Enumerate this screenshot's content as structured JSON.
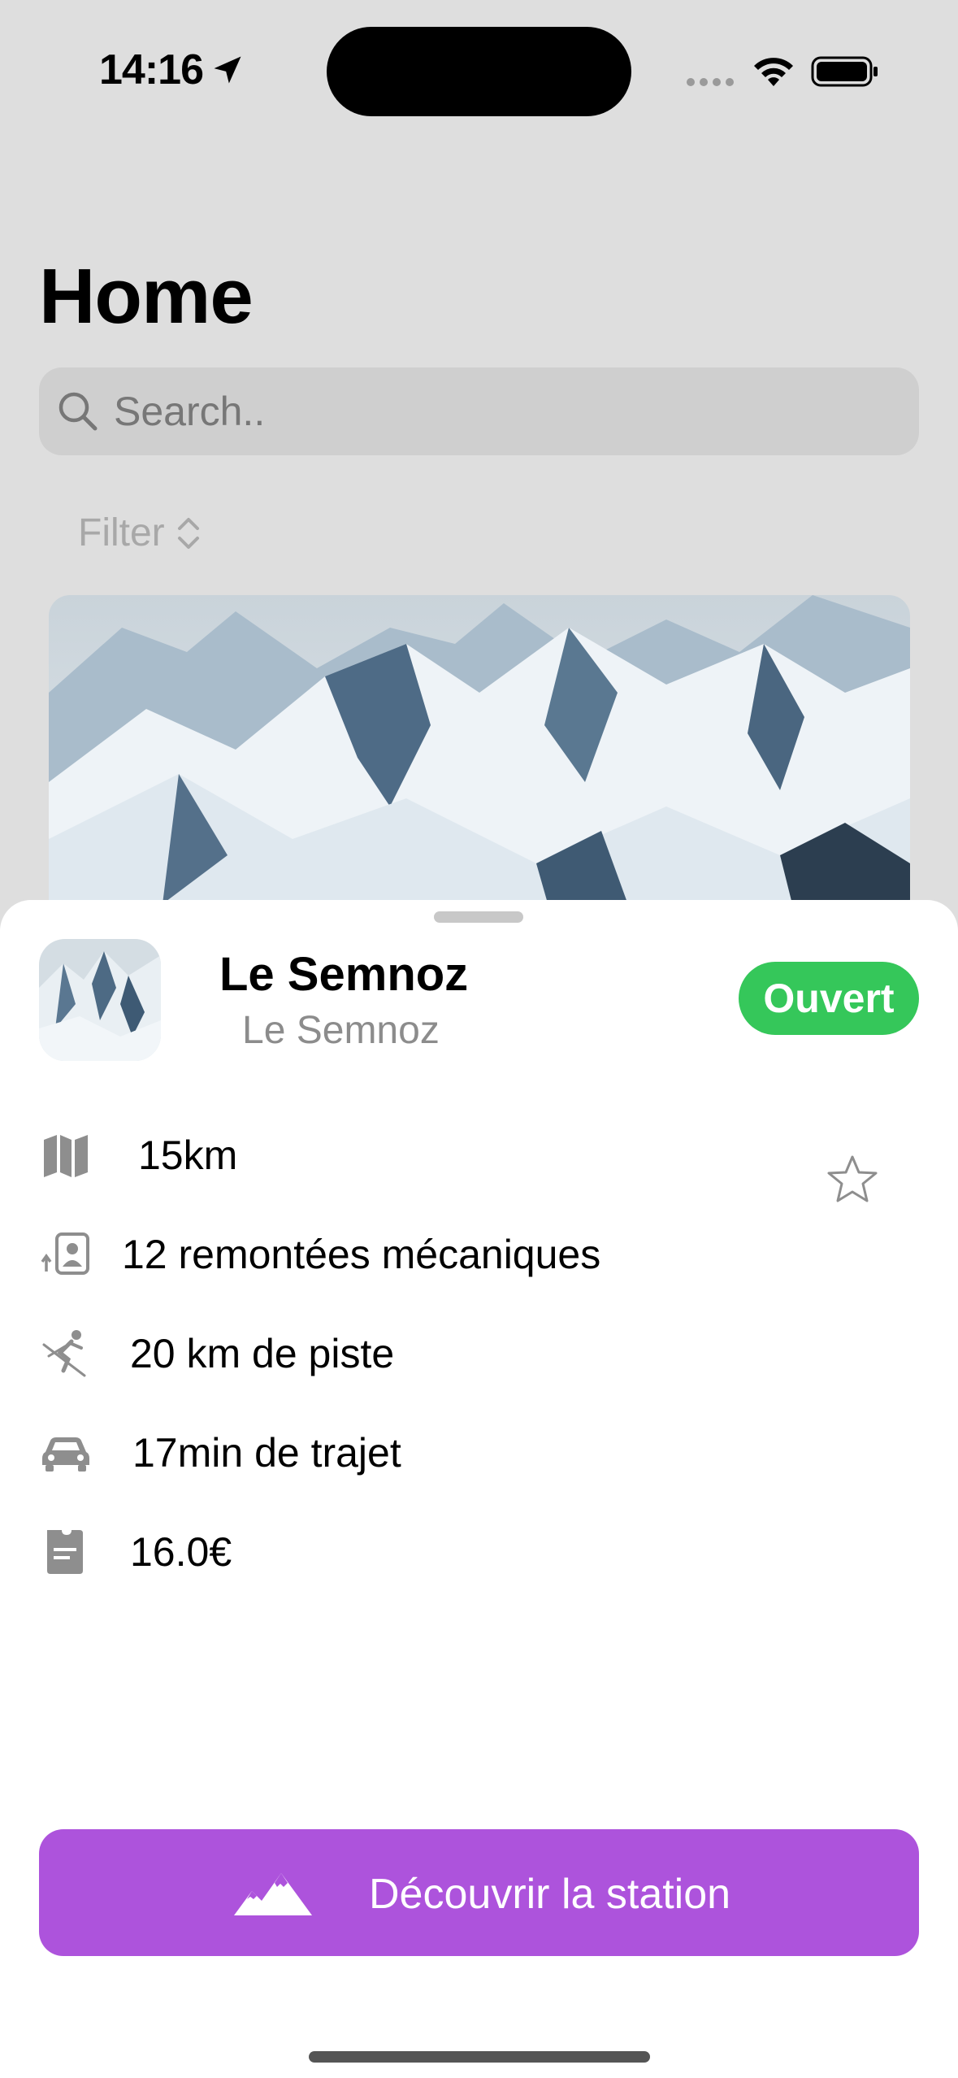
{
  "status_bar": {
    "time": "14:16"
  },
  "header": {
    "title": "Home"
  },
  "search": {
    "placeholder": "Search.."
  },
  "filter": {
    "label": "Filter"
  },
  "sheet": {
    "station_name": "Le Semnoz",
    "station_subtitle": "Le Semnoz",
    "status": "Ouvert",
    "status_color": "#35c75a",
    "details": [
      {
        "icon": "map-icon",
        "text": "15km"
      },
      {
        "icon": "ski-lift-icon",
        "text": "12 remontées mécaniques"
      },
      {
        "icon": "skier-icon",
        "text": "20 km de piste"
      },
      {
        "icon": "car-icon",
        "text": "17min de trajet"
      },
      {
        "icon": "ticket-icon",
        "text": "16.0€"
      }
    ],
    "favorite_icon": "star-outline-icon",
    "cta_label": "Découvrir la station",
    "cta_icon": "mountain-icon",
    "cta_color": "#ad53dc"
  }
}
